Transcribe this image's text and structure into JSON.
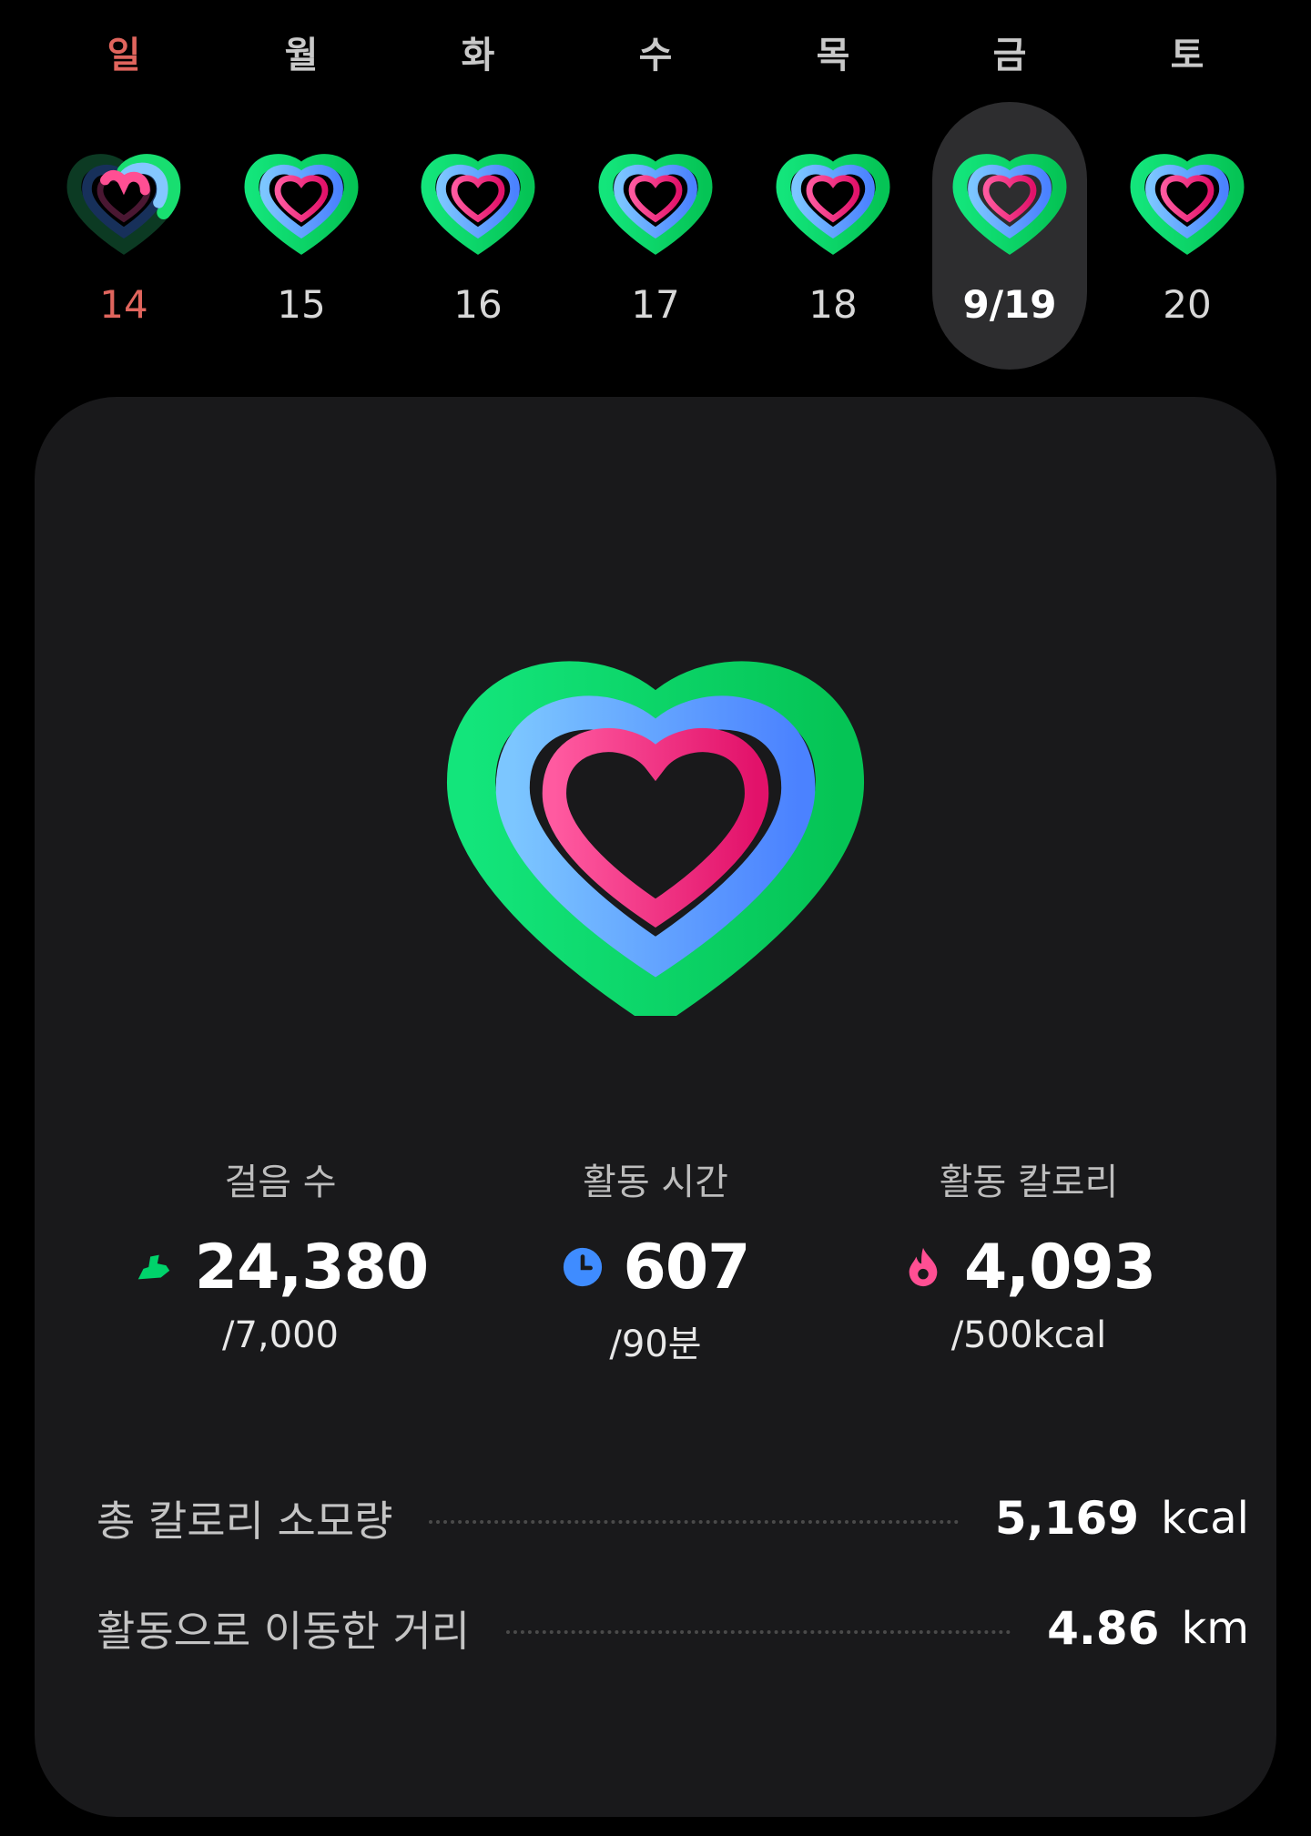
{
  "week": [
    {
      "dow": "일",
      "date": "14",
      "sunday": true
    },
    {
      "dow": "월",
      "date": "15"
    },
    {
      "dow": "화",
      "date": "16"
    },
    {
      "dow": "수",
      "date": "17"
    },
    {
      "dow": "목",
      "date": "18"
    },
    {
      "dow": "금",
      "date": "9/19",
      "selected": true
    },
    {
      "dow": "토",
      "date": "20"
    }
  ],
  "colors": {
    "steps": "#00d36b",
    "active_time": "#4c8dff",
    "calories": "#ff2e7e",
    "sunday": "#e0655d"
  },
  "stats": {
    "steps": {
      "label": "걸음 수",
      "value": "24,380",
      "goal": "/7,000",
      "icon": "shoe-icon"
    },
    "active_time": {
      "label": "활동 시간",
      "value": "607",
      "goal": "/90분",
      "icon": "clock-icon"
    },
    "calories": {
      "label": "활동 칼로리",
      "value": "4,093",
      "goal": "/500kcal",
      "icon": "flame-icon"
    }
  },
  "summary": [
    {
      "label": "총 칼로리 소모량",
      "value": "5,169",
      "unit": "kcal"
    },
    {
      "label": "활동으로 이동한 거리",
      "value": "4.86",
      "unit": "km"
    }
  ]
}
